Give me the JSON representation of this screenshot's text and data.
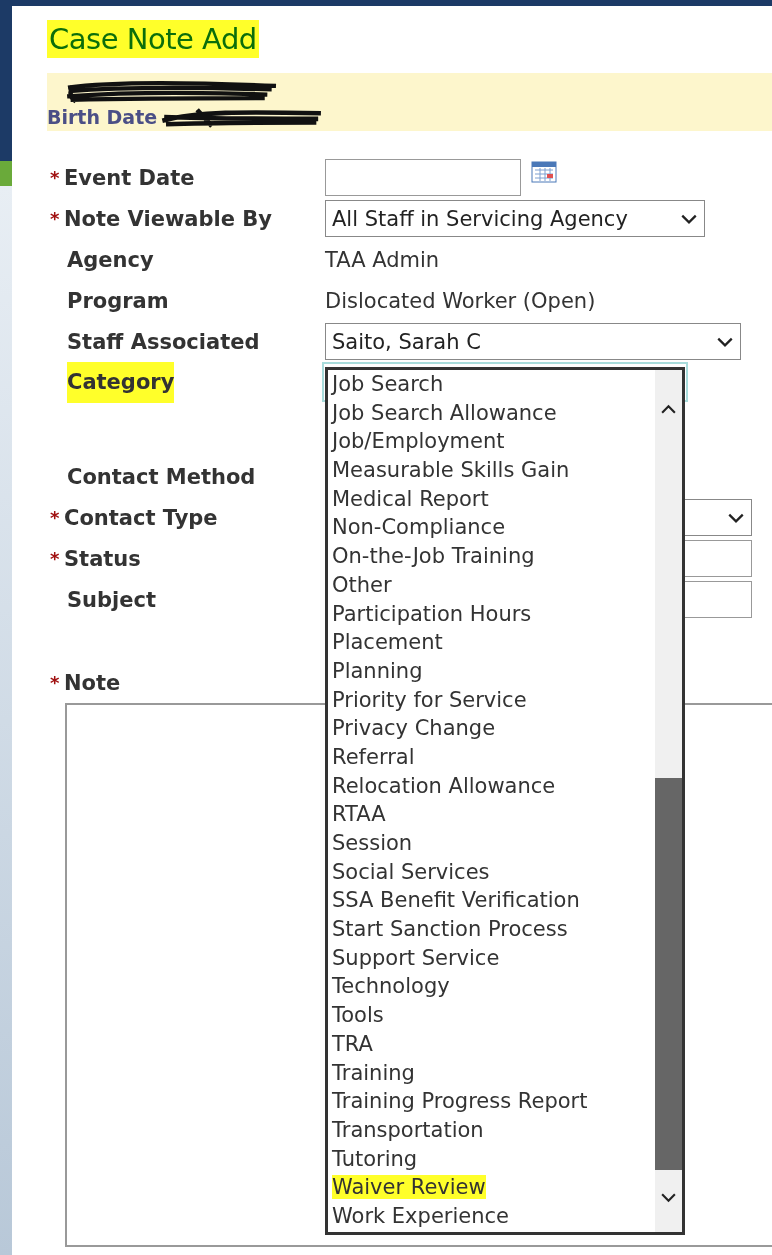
{
  "page": {
    "title": "Case Note Add",
    "title_highlighted": true
  },
  "client": {
    "birth_date_label": "Birth Date"
  },
  "fields": [
    {
      "kind": "date",
      "label": "Event Date",
      "required_mark": "*",
      "highlighted": false
    },
    {
      "kind": "select",
      "label": "Note Viewable By",
      "required_mark": "*",
      "highlighted": false,
      "value": "All Staff in Servicing Agency"
    },
    {
      "kind": "text",
      "label": "Agency",
      "highlighted": false,
      "value": "TAA Admin"
    },
    {
      "kind": "text",
      "label": "Program",
      "highlighted": false,
      "value": "Dislocated Worker (Open)"
    },
    {
      "kind": "wideselect",
      "label": "Staff Associated",
      "highlighted": false,
      "value": "Saito, Sarah C"
    },
    {
      "kind": "listbox",
      "label": "Category",
      "highlighted": true
    },
    {
      "kind": "blank",
      "label": "Contact Method",
      "highlighted": false
    },
    {
      "kind": "select",
      "label": "Contact Type",
      "required_mark": "*",
      "highlighted": false
    },
    {
      "kind": "input",
      "label": "Status",
      "required_mark": "*",
      "highlighted": false
    },
    {
      "kind": "input",
      "label": "Subject",
      "highlighted": false
    },
    {
      "kind": "textarea",
      "label": "Note",
      "required_mark": "*",
      "highlighted": false
    }
  ],
  "category_list": {
    "items": [
      {
        "label": "Job Search",
        "highlighted": false
      },
      {
        "label": "Job Search Allowance",
        "highlighted": false
      },
      {
        "label": "Job/Employment",
        "highlighted": false
      },
      {
        "label": "Measurable Skills Gain",
        "highlighted": false
      },
      {
        "label": "Medical Report",
        "highlighted": false
      },
      {
        "label": "Non-Compliance",
        "highlighted": false
      },
      {
        "label": "On-the-Job Training",
        "highlighted": false
      },
      {
        "label": "Other",
        "highlighted": false
      },
      {
        "label": "Participation Hours",
        "highlighted": false
      },
      {
        "label": "Placement",
        "highlighted": false
      },
      {
        "label": "Planning",
        "highlighted": false
      },
      {
        "label": "Priority for Service",
        "highlighted": false
      },
      {
        "label": "Privacy Change",
        "highlighted": false
      },
      {
        "label": "Referral",
        "highlighted": false
      },
      {
        "label": "Relocation Allowance",
        "highlighted": false
      },
      {
        "label": "RTAA",
        "highlighted": false
      },
      {
        "label": "Session",
        "highlighted": false
      },
      {
        "label": "Social Services",
        "highlighted": false
      },
      {
        "label": "SSA Benefit Verification",
        "highlighted": false
      },
      {
        "label": "Start Sanction Process",
        "highlighted": false
      },
      {
        "label": "Support Service",
        "highlighted": false
      },
      {
        "label": "Technology",
        "highlighted": false
      },
      {
        "label": "Tools",
        "highlighted": false
      },
      {
        "label": "TRA",
        "highlighted": false
      },
      {
        "label": "Training",
        "highlighted": false
      },
      {
        "label": "Training Progress Report",
        "highlighted": false
      },
      {
        "label": "Transportation",
        "highlighted": false
      },
      {
        "label": "Tutoring",
        "highlighted": false
      },
      {
        "label": "Waiver Review",
        "highlighted": true
      },
      {
        "label": "Work Experience",
        "highlighted": false
      }
    ]
  }
}
